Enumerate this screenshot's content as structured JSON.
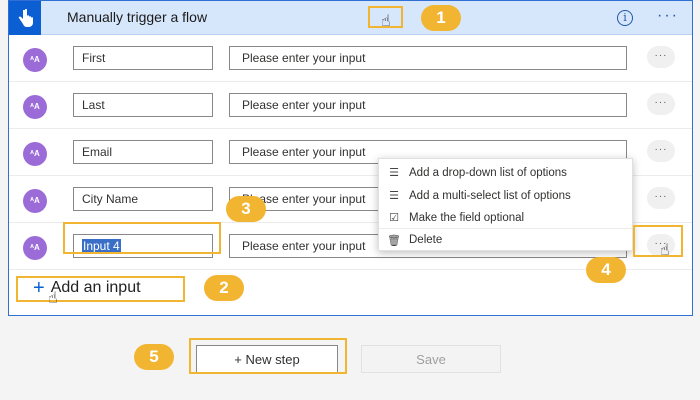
{
  "trigger": {
    "title": "Manually trigger a flow",
    "info_icon": "i",
    "more_icon": "···"
  },
  "inputs": [
    {
      "avatar": "ᴬA",
      "name": "First",
      "value": "Please enter your input"
    },
    {
      "avatar": "ᴬA",
      "name": "Last",
      "value": "Please enter your input"
    },
    {
      "avatar": "ᴬA",
      "name": "Email",
      "value": "Please enter your input"
    },
    {
      "avatar": "ᴬA",
      "name": "City Name",
      "value": "Please enter your input"
    },
    {
      "avatar": "ᴬA",
      "name": "Input 4",
      "value": "Please enter your input"
    }
  ],
  "row_more_icon": "···",
  "add_input_label": "Add an input",
  "context_menu": {
    "items": [
      {
        "icon": "list-icon",
        "label": "Add a drop-down list of options"
      },
      {
        "icon": "list-icon",
        "label": "Add a multi-select list of options"
      },
      {
        "icon": "checkbox-icon",
        "label": "Make the field optional"
      },
      {
        "icon": "trash-icon",
        "label": "Delete"
      }
    ]
  },
  "footer": {
    "new_step_label": "+ New step",
    "save_label": "Save"
  },
  "callouts": [
    "1",
    "2",
    "3",
    "4",
    "5"
  ],
  "colors": {
    "accent": "#0b5fd3",
    "header_bg": "#d6e6fb",
    "callout": "#f2b531",
    "avatar": "#9b6bd8"
  }
}
